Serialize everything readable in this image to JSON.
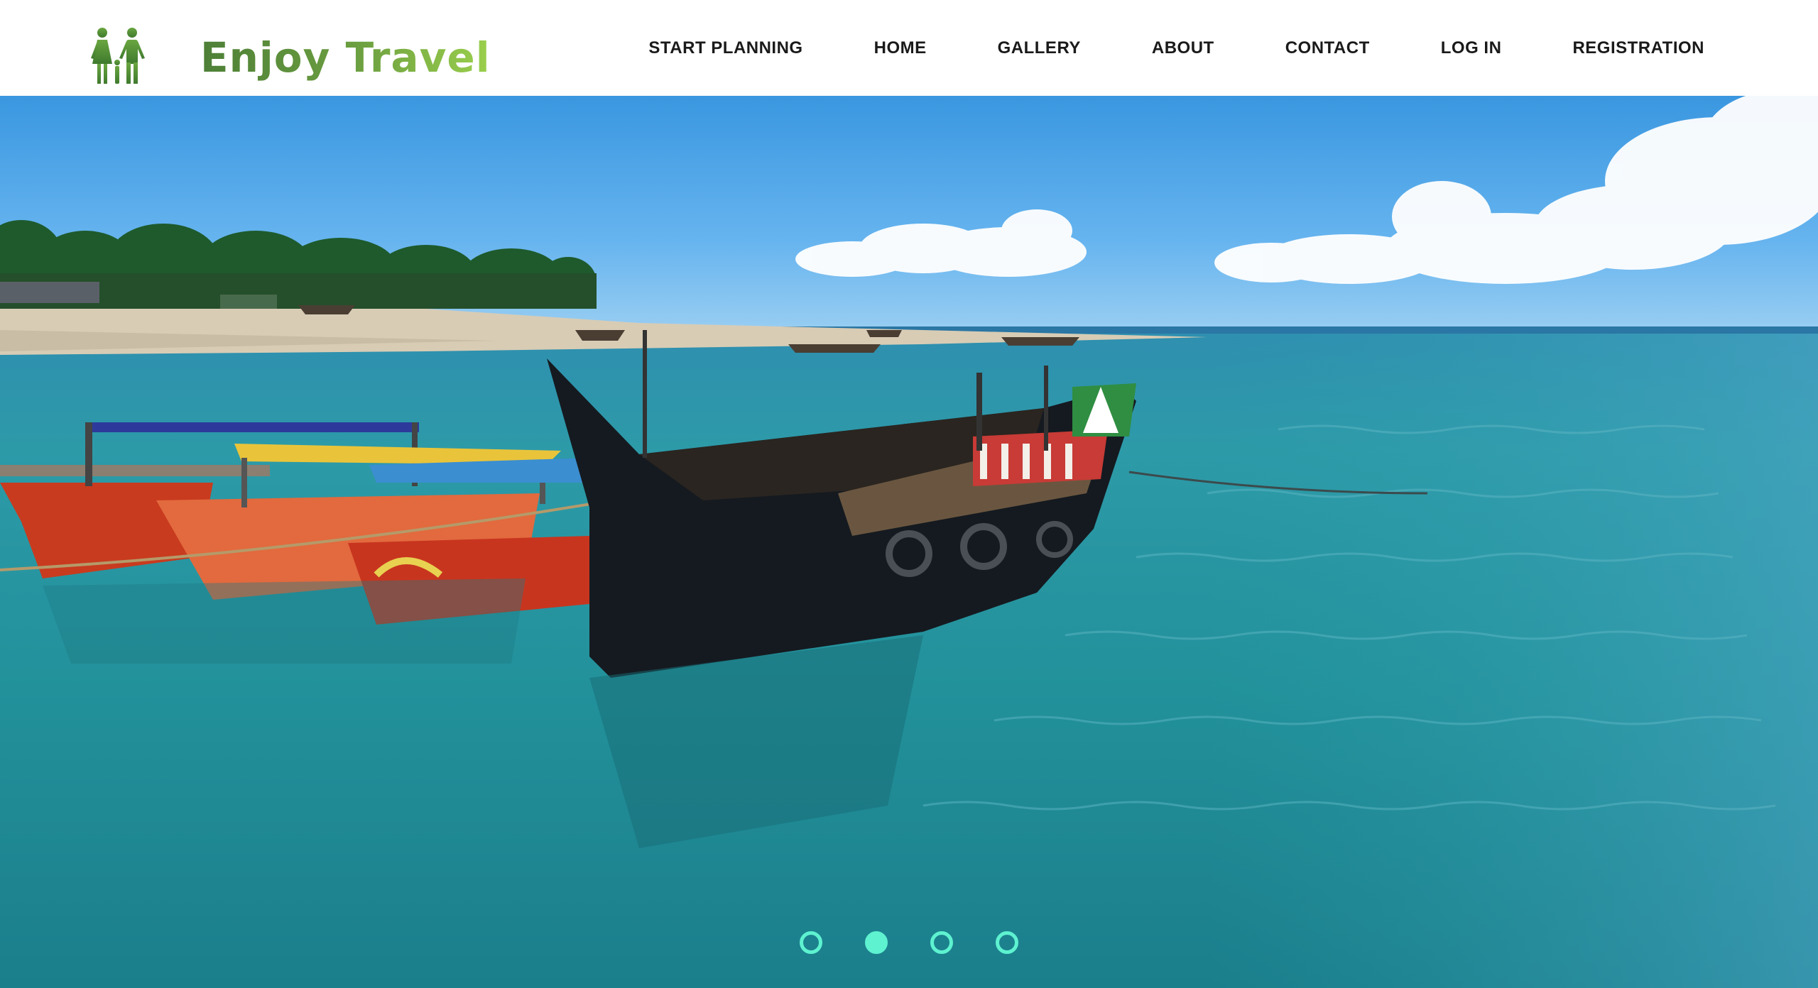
{
  "brand": {
    "name": "Enjoy Travel",
    "logo_icon": "two-people-icon",
    "colors": {
      "dark": "#4d7f37",
      "light": "#9bd04d"
    }
  },
  "nav": {
    "items": [
      {
        "label": "START PLANNING"
      },
      {
        "label": "HOME"
      },
      {
        "label": "GALLERY"
      },
      {
        "label": "ABOUT"
      },
      {
        "label": "CONTACT"
      },
      {
        "label": "LOG IN"
      },
      {
        "label": "REGISTRATION"
      }
    ]
  },
  "hero": {
    "image": "boats-on-turquoise-sea-beach",
    "slides_total": 4,
    "active_slide": 2,
    "indicator_color": "#5ef2d0"
  }
}
